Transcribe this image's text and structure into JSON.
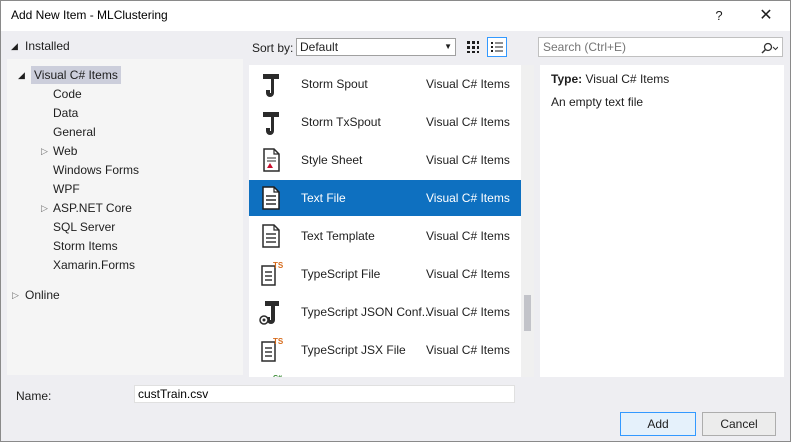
{
  "window": {
    "title": "Add New Item - MLClustering",
    "help": "?",
    "close": "✕"
  },
  "tree": {
    "installed": "Installed",
    "root": "Visual C# Items",
    "children": [
      "Code",
      "Data",
      "General",
      "Web",
      "Windows Forms",
      "WPF",
      "ASP.NET Core",
      "SQL Server",
      "Storm Items",
      "Xamarin.Forms"
    ],
    "online": "Online"
  },
  "toolbar": {
    "sort_label": "Sort by:",
    "sort_value": "Default",
    "search_placeholder": "Search (Ctrl+E)"
  },
  "items": [
    {
      "name": "Storm Spout",
      "category": "Visual C# Items",
      "icon": "storm-spout-icon"
    },
    {
      "name": "Storm TxSpout",
      "category": "Visual C# Items",
      "icon": "storm-txspout-icon"
    },
    {
      "name": "Style Sheet",
      "category": "Visual C# Items",
      "icon": "style-sheet-icon"
    },
    {
      "name": "Text File",
      "category": "Visual C# Items",
      "icon": "text-file-icon",
      "selected": true
    },
    {
      "name": "Text Template",
      "category": "Visual C# Items",
      "icon": "text-template-icon"
    },
    {
      "name": "TypeScript File",
      "category": "Visual C# Items",
      "icon": "typescript-file-icon"
    },
    {
      "name": "TypeScript JSON Conf...",
      "category": "Visual C# Items",
      "icon": "typescript-json-config-icon"
    },
    {
      "name": "TypeScript JSX File",
      "category": "Visual C# Items",
      "icon": "typescript-jsx-file-icon"
    }
  ],
  "details": {
    "type_label": "Type:",
    "type_value": "Visual C# Items",
    "description": "An empty text file"
  },
  "form": {
    "name_label": "Name:",
    "name_value": "custTrain.csv",
    "add": "Add",
    "cancel": "Cancel"
  },
  "colors": {
    "selection": "#0e70c0",
    "tree_selection": "#cccedb",
    "dialog_bg": "#eeeef2"
  }
}
